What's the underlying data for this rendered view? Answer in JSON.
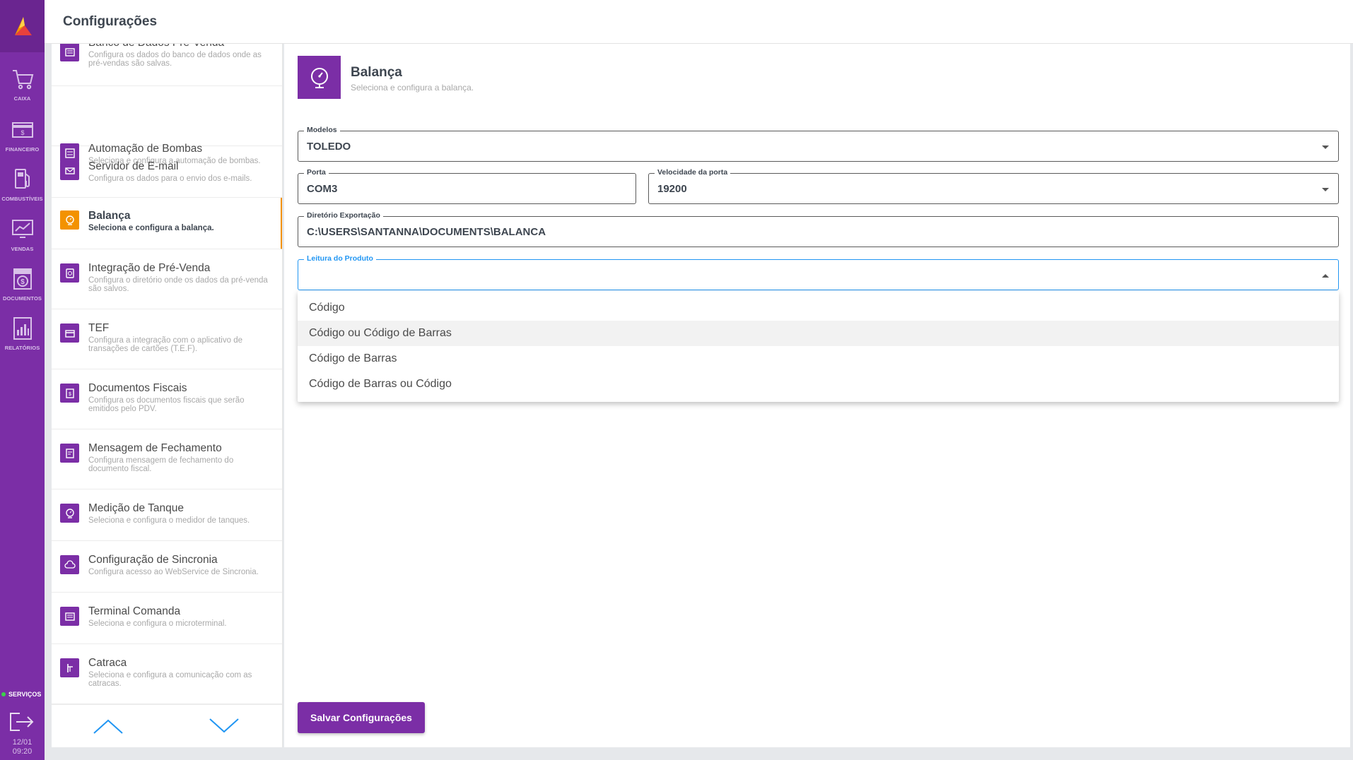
{
  "header": {
    "title": "Configurações"
  },
  "rail": {
    "items": [
      {
        "label": "CAIXA",
        "icon": "cart-icon"
      },
      {
        "label": "FINANCEIRO",
        "icon": "money-icon"
      },
      {
        "label": "COMBUSTÍVEIS",
        "icon": "fuel-pump-icon"
      },
      {
        "label": "VENDAS",
        "icon": "sales-chart-icon"
      },
      {
        "label": "DOCUMENTOS",
        "icon": "documents-icon"
      },
      {
        "label": "RELATÓRIOS",
        "icon": "reports-icon"
      }
    ],
    "services_label": "SERVIÇOS",
    "date": "12/01",
    "time": "09:20"
  },
  "sidebar": {
    "items": [
      {
        "title": "Banco de Dados Pré-Venda",
        "desc": "Configura os dados do banco de dados onde as pré-vendas são salvas."
      },
      {
        "title": "Automação de Bombas",
        "desc": "Seleciona e configura a automação de bombas."
      },
      {
        "title": "Servidor de E-mail",
        "desc": "Configura os dados para o envio dos e-mails."
      },
      {
        "title": "Balança",
        "desc": "Seleciona e configura a balança."
      },
      {
        "title": "Integração de Pré-Venda",
        "desc": "Configura o diretório onde os dados da pré-venda são salvos."
      },
      {
        "title": "TEF",
        "desc": "Configura a integração com o aplicativo de transações de cartões (T.E.F)."
      },
      {
        "title": "Documentos Fiscais",
        "desc": "Configura os documentos fiscais que serão emitidos pelo PDV."
      },
      {
        "title": "Mensagem de Fechamento",
        "desc": "Configura mensagem de fechamento do documento fiscal."
      },
      {
        "title": "Medição de Tanque",
        "desc": "Seleciona e configura o medidor de tanques."
      },
      {
        "title": "Configuração de Sincronia",
        "desc": "Configura acesso ao WebService de Sincronia."
      },
      {
        "title": "Terminal Comanda",
        "desc": "Seleciona e configura o microterminal."
      },
      {
        "title": "Catraca",
        "desc": "Seleciona e configura a comunicação com as catracas."
      }
    ],
    "active_index": 3
  },
  "section": {
    "title": "Balança",
    "subtitle": "Seleciona e configura a balança.",
    "icon": "scale-icon"
  },
  "form": {
    "modelos": {
      "label": "Modelos",
      "value": "TOLEDO"
    },
    "porta": {
      "label": "Porta",
      "value": "COM3"
    },
    "velocidade": {
      "label": "Velocidade da porta",
      "value": "19200"
    },
    "diretorio": {
      "label": "Diretório Exportação",
      "value": "C:\\USERS\\SANTANNA\\DOCUMENTS\\BALANCA"
    },
    "leitura": {
      "label": "Leitura do Produto",
      "value": "",
      "options": [
        "Código",
        "Código ou Código de Barras",
        "Código de Barras",
        "Código de Barras ou Código"
      ],
      "highlighted_index": 1
    }
  },
  "save_button": "Salvar Configurações",
  "colors": {
    "primary": "#7b2ea6",
    "active": "#f39200",
    "focus": "#2196f3",
    "arrows": "#2196f3"
  }
}
